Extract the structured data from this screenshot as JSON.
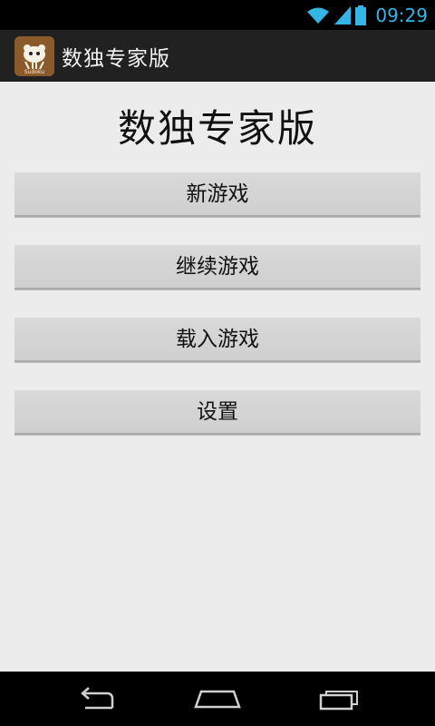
{
  "status_bar": {
    "time": "09:29",
    "icons": [
      "wifi-icon",
      "signal-icon",
      "battery-icon"
    ],
    "accent_color": "#33b5e5"
  },
  "action_bar": {
    "app_icon": "sudoku-app-icon",
    "app_icon_text": "Sudoku",
    "title": "数独专家版"
  },
  "main": {
    "title": "数独专家版",
    "buttons": [
      {
        "label": "新游戏"
      },
      {
        "label": "继续游戏"
      },
      {
        "label": "载入游戏"
      },
      {
        "label": "设置"
      }
    ]
  },
  "nav_bar": {
    "icons": [
      "back-icon",
      "home-icon",
      "recent-apps-icon"
    ]
  }
}
